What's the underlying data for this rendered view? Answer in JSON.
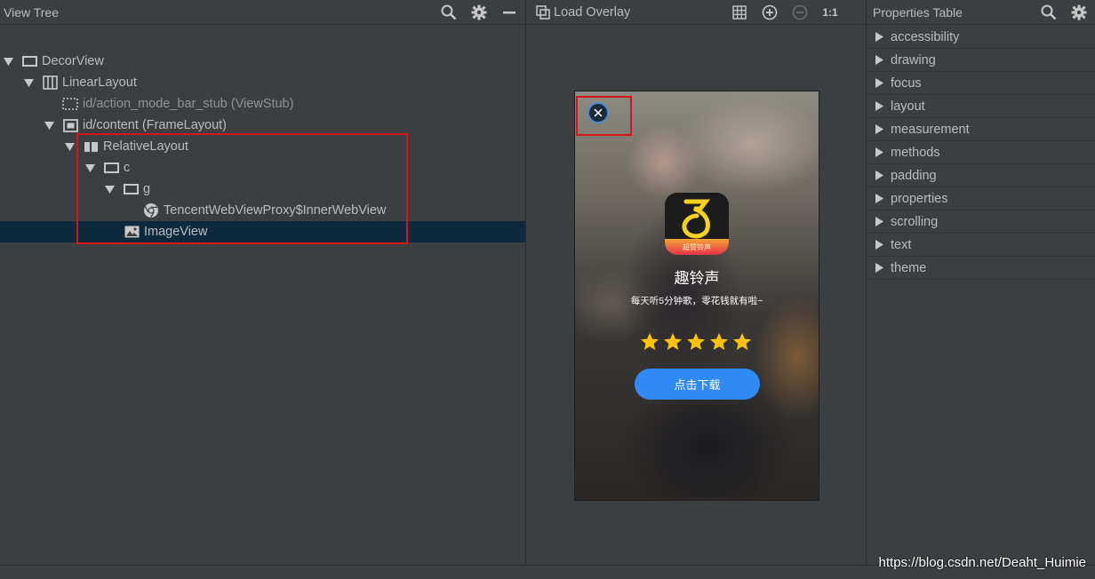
{
  "view_tree": {
    "title": "View Tree",
    "rows": [
      {
        "label": "DecorView",
        "icon": "frame-icon",
        "dim": false
      },
      {
        "label": "LinearLayout",
        "icon": "linear-layout-icon",
        "dim": false
      },
      {
        "label": "id/action_mode_bar_stub (ViewStub)",
        "icon": "viewstub-icon",
        "dim": true
      },
      {
        "label": "id/content (FrameLayout)",
        "icon": "frame-layout-icon",
        "dim": false
      },
      {
        "label": "RelativeLayout",
        "icon": "relative-layout-icon",
        "dim": false
      },
      {
        "label": "c",
        "icon": "view-icon",
        "dim": false
      },
      {
        "label": "g",
        "icon": "view-icon",
        "dim": false
      },
      {
        "label": "TencentWebViewProxy$InnerWebView",
        "icon": "webview-icon",
        "dim": false
      },
      {
        "label": "ImageView",
        "icon": "image-icon",
        "dim": false
      }
    ],
    "selected_row": "ImageView"
  },
  "preview": {
    "load_overlay_label": "Load Overlay",
    "zoom_label": "1:1",
    "app_name": "趣铃声",
    "app_description": "每天听5分钟歌，零花钱就有啦~",
    "star_rating": 5,
    "download_button": "点击下载",
    "icon_band_text": "超赞铃声"
  },
  "properties_table": {
    "title": "Properties Table",
    "items": [
      "accessibility",
      "drawing",
      "focus",
      "layout",
      "measurement",
      "methods",
      "padding",
      "properties",
      "scrolling",
      "text",
      "theme"
    ]
  },
  "watermark": "https://blog.csdn.net/Deaht_Huimie",
  "colors": {
    "panel_bg": "#3c3f41",
    "selected_row": "#0d293e",
    "highlight_box": "#d4151b",
    "star": "#ffc20e",
    "download_button": "#2f8af5"
  }
}
